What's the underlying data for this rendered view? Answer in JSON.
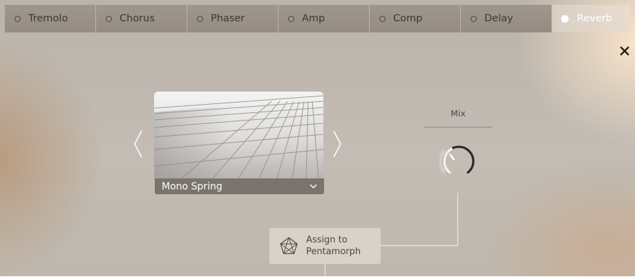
{
  "tabs": [
    {
      "label": "Tremolo",
      "active": false
    },
    {
      "label": "Chorus",
      "active": false
    },
    {
      "label": "Phaser",
      "active": false
    },
    {
      "label": "Amp",
      "active": false
    },
    {
      "label": "Comp",
      "active": false
    },
    {
      "label": "Delay",
      "active": false
    },
    {
      "label": "Reverb",
      "active": true
    }
  ],
  "preset": {
    "name": "Mono Spring"
  },
  "mix": {
    "label": "Mix"
  },
  "assign": {
    "line1": "Assign to",
    "line2": "Pentamorph"
  },
  "colors": {
    "tab_background": "#9a9188",
    "active_tab_background": "#e4d8ca",
    "preset_bar": "#7a746d",
    "assign_background": "#d9d2c9",
    "knob_ring": "#2e2a27"
  },
  "icons": {
    "close": "close-icon",
    "prev": "chevron-left-icon",
    "next": "chevron-right-icon",
    "dropdown": "chevron-down-icon",
    "assign": "pentagon-icon"
  }
}
